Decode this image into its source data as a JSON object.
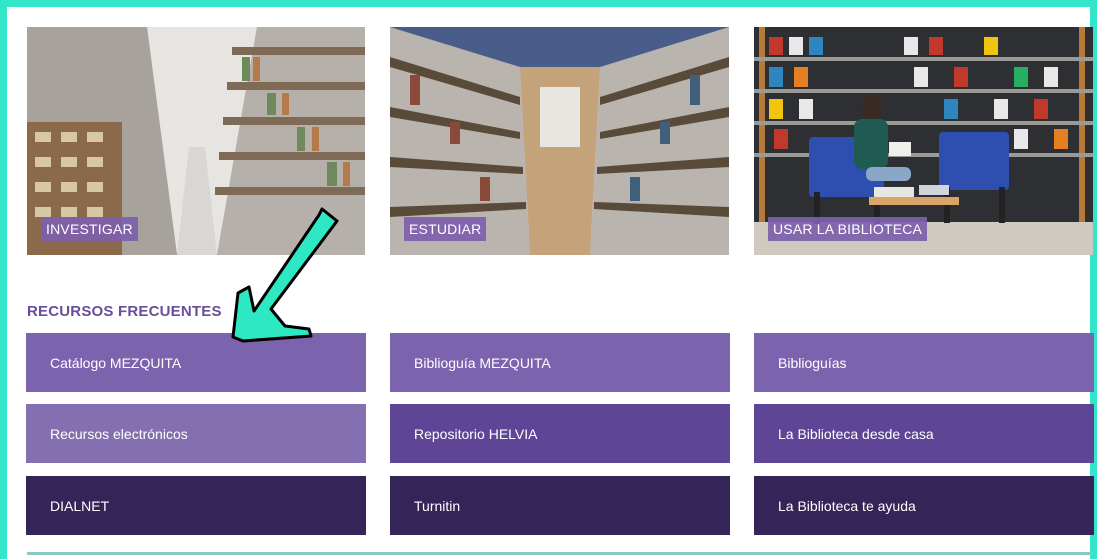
{
  "cards": [
    {
      "label": "INVESTIGAR"
    },
    {
      "label": "ESTUDIAR"
    },
    {
      "label": "USAR LA BIBLIOTECA"
    }
  ],
  "section": {
    "title": "RECURSOS FRECUENTES"
  },
  "resources": [
    {
      "label": "Catálogo MEZQUITA",
      "color": "#7b63ae"
    },
    {
      "label": "Biblioguía MEZQUITA",
      "color": "#7b63ae"
    },
    {
      "label": "Biblioguías",
      "color": "#7b63ae"
    },
    {
      "label": "Recursos electrónicos",
      "color": "#8470b0"
    },
    {
      "label": "Repositorio HELVIA",
      "color": "#5e4596"
    },
    {
      "label": "La Biblioteca desde casa",
      "color": "#5e4596"
    },
    {
      "label": "DIALNET",
      "color": "#342458"
    },
    {
      "label": "Turnitin",
      "color": "#342458"
    },
    {
      "label": "La Biblioteca te ayuda",
      "color": "#342458"
    }
  ],
  "colors": {
    "frame": "#33e6c9",
    "accent": "#6a4d9b",
    "arrow": "#2ee8c4"
  }
}
